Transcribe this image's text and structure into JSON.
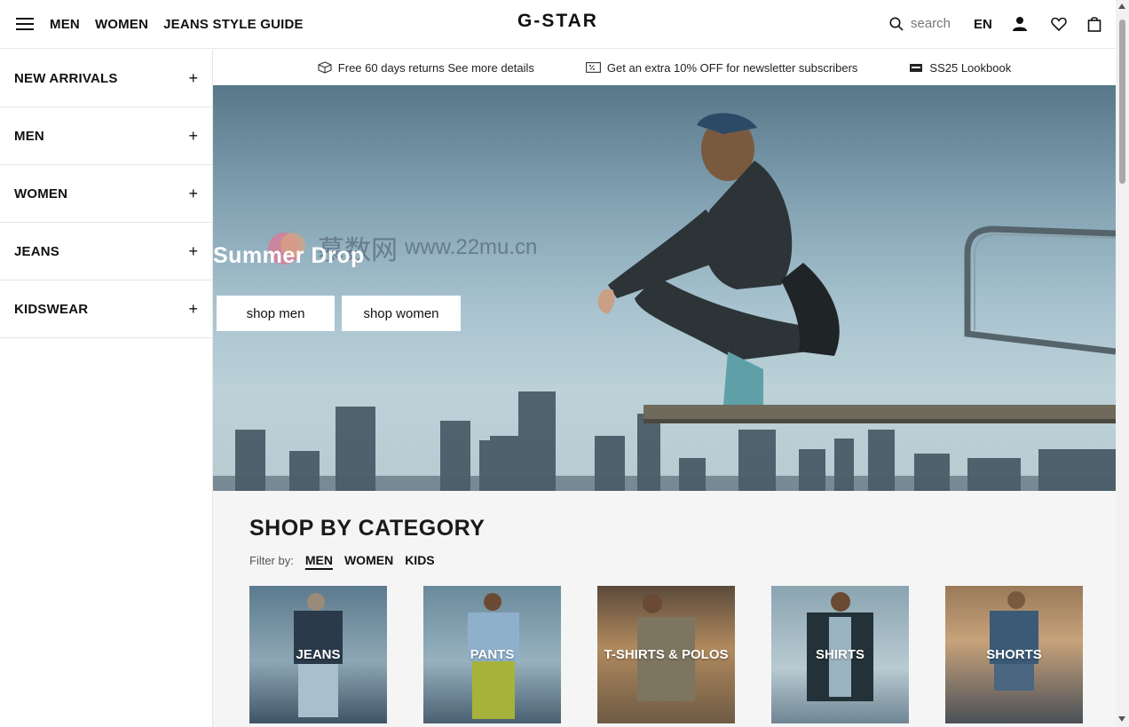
{
  "header": {
    "nav": [
      "MEN",
      "WOMEN",
      "JEANS STYLE GUIDE"
    ],
    "logo": "G-STAR",
    "search_placeholder": "search",
    "language": "EN"
  },
  "sidebar": {
    "items": [
      {
        "label": "NEW ARRIVALS",
        "icon": "plus-icon"
      },
      {
        "label": "MEN",
        "icon": "plus-icon"
      },
      {
        "label": "WOMEN",
        "icon": "plus-icon"
      },
      {
        "label": "JEANS",
        "icon": "plus-icon"
      },
      {
        "label": "KIDSWEAR",
        "icon": "plus-icon"
      }
    ]
  },
  "promo": [
    {
      "icon": "box-icon",
      "text": "Free 60 days returns See more details"
    },
    {
      "icon": "discount-icon",
      "text": "Get an extra 10% OFF for newsletter subscribers"
    },
    {
      "icon": "g-logo-icon",
      "text": "SS25 Lookbook"
    }
  ],
  "hero": {
    "title": "Summer Drop",
    "buttons": [
      "shop men",
      "shop women"
    ],
    "watermark": "慕数网",
    "watermark_url": "www.22mu.cn"
  },
  "category": {
    "title": "SHOP BY CATEGORY",
    "filter_label": "Filter by:",
    "filters": [
      "MEN",
      "WOMEN",
      "KIDS"
    ],
    "active_filter": "MEN",
    "cards": [
      "JEANS",
      "PANTS",
      "T-SHIRTS & POLOS",
      "SHIRTS",
      "SHORTS"
    ]
  },
  "colors": {
    "text": "#111111",
    "border": "#e6e6e6",
    "section_bg": "#f5f5f5",
    "hero_sky": "#7d9dae"
  }
}
